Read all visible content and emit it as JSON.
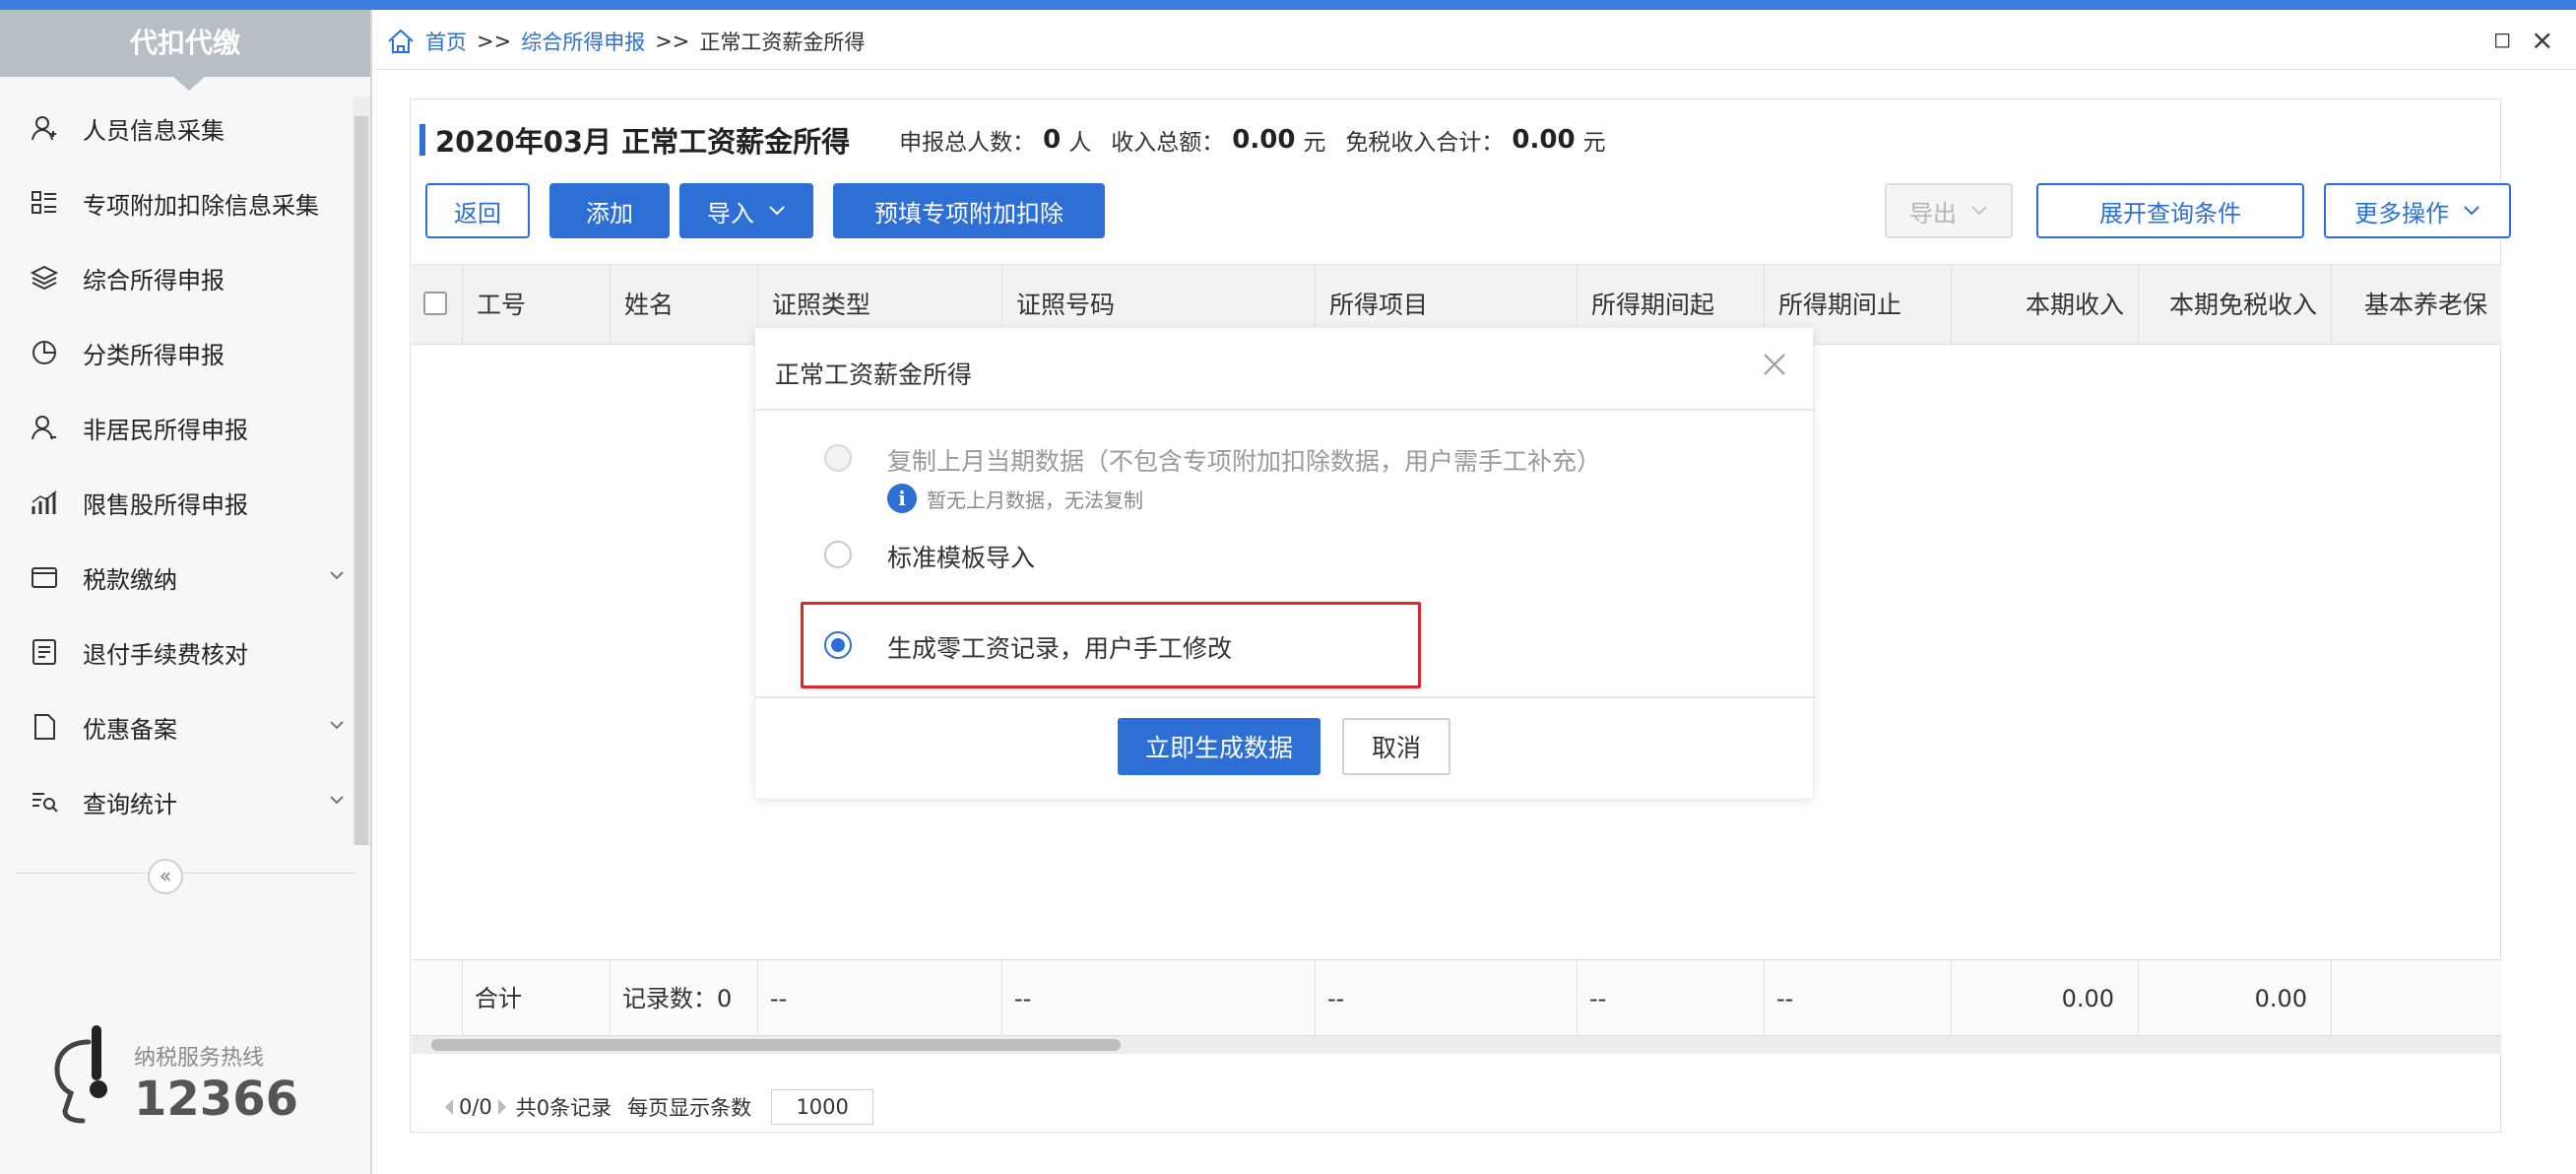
{
  "colors": {
    "accent": "#2d6fd4",
    "highlight": "#e0242a",
    "sidebar_head": "#b9bec4"
  },
  "sidebar": {
    "title": "代扣代缴",
    "items": [
      {
        "label": "人员信息采集",
        "icon": "person-icon"
      },
      {
        "label": "专项附加扣除信息采集",
        "icon": "list-icon"
      },
      {
        "label": "综合所得申报",
        "icon": "layers-icon"
      },
      {
        "label": "分类所得申报",
        "icon": "pie-icon"
      },
      {
        "label": "非居民所得申报",
        "icon": "user-icon"
      },
      {
        "label": "限售股所得申报",
        "icon": "bar-chart-icon"
      },
      {
        "label": "税款缴纳",
        "icon": "folder-icon",
        "expandable": true
      },
      {
        "label": "退付手续费核对",
        "icon": "receipt-icon"
      },
      {
        "label": "优惠备案",
        "icon": "document-icon",
        "expandable": true
      },
      {
        "label": "查询统计",
        "icon": "search-list-icon",
        "expandable": true
      }
    ],
    "collapse_symbol": "«",
    "hotline_label": "纳税服务热线",
    "hotline_number": "12366"
  },
  "breadcrumb": {
    "home": "首页",
    "sep": ">>",
    "level1": "综合所得申报",
    "current": "正常工资薪金所得"
  },
  "window": {
    "restore_symbol": "◻",
    "close_symbol": "×"
  },
  "header": {
    "title": "2020年03月 正常工资薪金所得",
    "total_people_label": "申报总人数：",
    "total_people_value": "0",
    "total_people_unit": "人",
    "income_label": "收入总额：",
    "income_value": "0.00",
    "income_unit": "元",
    "taxfree_label": "免税收入合计：",
    "taxfree_value": "0.00",
    "taxfree_unit": "元"
  },
  "toolbar": {
    "back": "返回",
    "add": "添加",
    "import": "导入",
    "prefill": "预填专项附加扣除",
    "export": "导出",
    "expand_query": "展开查询条件",
    "more": "更多操作"
  },
  "table": {
    "columns": [
      "工号",
      "姓名",
      "证照类型",
      "证照号码",
      "所得项目",
      "所得期间起",
      "所得期间止",
      "本期收入",
      "本期免税收入",
      "基本养老保"
    ],
    "footer": {
      "total": "合计",
      "records": "记录数：0",
      "cells": [
        "--",
        "--",
        "--",
        "--",
        "--"
      ],
      "income": "0.00",
      "taxfree": "0.00"
    }
  },
  "pager": {
    "pages": "0/0",
    "total": "共0条记录",
    "per_page_label": "每页显示条数",
    "per_page": "1000"
  },
  "modal": {
    "title": "正常工资薪金所得",
    "option1": "复制上月当期数据（不包含专项附加扣除数据，用户需手工补充）",
    "hint": "暂无上月数据，无法复制",
    "option2": "标准模板导入",
    "option3": "生成零工资记录，用户手工修改",
    "confirm": "立即生成数据",
    "cancel": "取消"
  }
}
